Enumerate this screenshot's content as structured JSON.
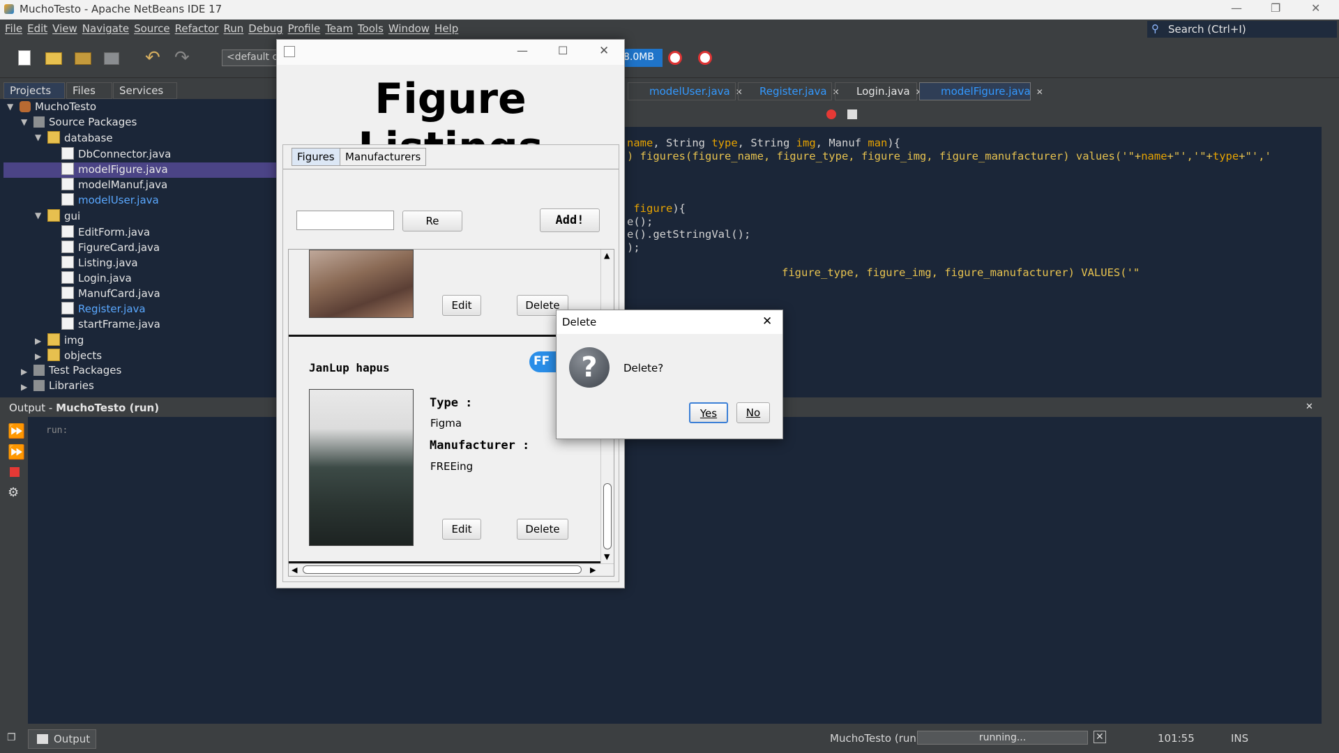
{
  "ide": {
    "title": "MuchoTesto - Apache NetBeans IDE 17",
    "menu": [
      "File",
      "Edit",
      "View",
      "Navigate",
      "Source",
      "Refactor",
      "Run",
      "Debug",
      "Profile",
      "Team",
      "Tools",
      "Window",
      "Help"
    ],
    "search_placeholder": "Search (Ctrl+I)",
    "config": "<default config>",
    "memory": "8.0MB",
    "panel_tabs": [
      "Projects",
      "Files",
      "Services"
    ],
    "tree": {
      "project": "MuchoTesto",
      "source_packages": "Source Packages",
      "database": "database",
      "database_files": [
        "DbConnector.java",
        "modelFigure.java",
        "modelManuf.java",
        "modelUser.java"
      ],
      "gui": "gui",
      "gui_files": [
        "EditForm.java",
        "FigureCard.java",
        "Listing.java",
        "Login.java",
        "ManufCard.java",
        "Register.java",
        "startFrame.java"
      ],
      "img": "img",
      "objects": "objects",
      "test_packages": "Test Packages",
      "libraries": "Libraries"
    },
    "editor_tabs": [
      "modelUser.java",
      "Register.java",
      "Login.java",
      "modelFigure.java"
    ],
    "code_lines": [
      {
        "parts": [
          [
            "kw",
            "name"
          ],
          [
            "t",
            ", String "
          ],
          [
            "kw",
            "type"
          ],
          [
            "t",
            ", String "
          ],
          [
            "kw",
            "img"
          ],
          [
            "t",
            ", Manuf "
          ],
          [
            "kw",
            "man"
          ],
          [
            "t",
            "){"
          ]
        ]
      },
      {
        "parts": [
          [
            "str",
            ") figures(figure_name, figure_type, figure_img, figure_manufacturer) values('\"+"
          ],
          [
            "kw",
            "name"
          ],
          [
            "str",
            "+\"','\"+"
          ],
          [
            "kw",
            "type"
          ],
          [
            "str",
            "+\"','"
          ]
        ]
      },
      {
        "parts": [
          [
            "t",
            ""
          ]
        ]
      },
      {
        "parts": [
          [
            "t",
            ""
          ]
        ]
      },
      {
        "parts": [
          [
            "t",
            " "
          ],
          [
            "kw",
            "figure"
          ],
          [
            "t",
            "){"
          ]
        ]
      },
      {
        "parts": [
          [
            "t",
            "e();"
          ]
        ]
      },
      {
        "parts": [
          [
            "t",
            "e().getStringVal();"
          ]
        ]
      },
      {
        "parts": [
          [
            "t",
            ");"
          ]
        ]
      },
      {
        "parts": [
          [
            "str",
            "figure_type, figure_img, figure_manufacturer) VALUES('\""
          ]
        ]
      }
    ],
    "output_title_prefix": "Output - ",
    "output_title_bold": "MuchoTesto (run)",
    "output_text": "run:",
    "status": {
      "output_tab": "Output",
      "task": "MuchoTesto (run)",
      "progress": "running...",
      "position": "101:55",
      "mode": "INS"
    }
  },
  "figure_window": {
    "heading": "Figure Listings",
    "tabs": [
      "Figures",
      "Manufacturers"
    ],
    "search_value": "",
    "refresh_label": "Re",
    "add_label": "Add!",
    "cards": [
      {
        "edit": "Edit",
        "delete": "Delete"
      },
      {
        "name": "JanLup hapus",
        "type_label": "Type :",
        "type": "Figma",
        "manufacturer_label": "Manufacturer :",
        "manufacturer": "FREEing",
        "edit": "Edit",
        "delete": "Delete",
        "badge": "FF"
      }
    ]
  },
  "dialog": {
    "title": "Delete",
    "message": "Delete?",
    "yes": "Yes",
    "no": "No"
  }
}
